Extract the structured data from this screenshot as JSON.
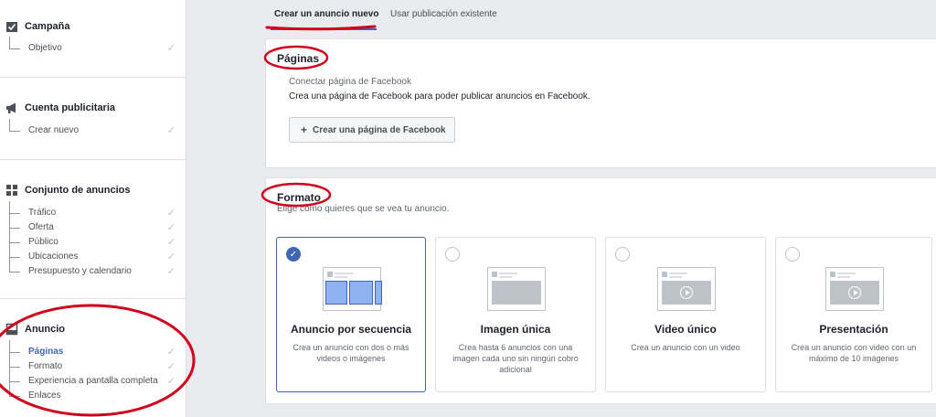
{
  "sidebar": {
    "sections": [
      {
        "title": "Campaña",
        "icon": "checkbox-icon",
        "items": [
          {
            "label": "Objetivo"
          }
        ]
      },
      {
        "title": "Cuenta publicitaria",
        "icon": "megaphone-icon",
        "items": [
          {
            "label": "Crear nuevo"
          }
        ]
      },
      {
        "title": "Conjunto de anuncios",
        "icon": "grid-icon",
        "items": [
          {
            "label": "Tráfico"
          },
          {
            "label": "Oferta"
          },
          {
            "label": "Público"
          },
          {
            "label": "Ubicaciones"
          },
          {
            "label": "Presupuesto y calendario"
          }
        ]
      },
      {
        "title": "Anuncio",
        "icon": "ad-icon",
        "items": [
          {
            "label": "Páginas",
            "active": true
          },
          {
            "label": "Formato"
          },
          {
            "label": "Experiencia a pantalla completa"
          },
          {
            "label": "Enlaces"
          }
        ]
      }
    ],
    "check_glyph": "✓"
  },
  "tabs": [
    {
      "label": "Crear un anuncio nuevo",
      "active": true
    },
    {
      "label": "Usar publicación existente",
      "active": false
    }
  ],
  "pages_card": {
    "title": "Páginas",
    "subtitle": "Conectar página de Facebook",
    "description": "Crea una página de Facebook para poder publicar anuncios en Facebook.",
    "button_label": "Crear una página de Facebook",
    "button_plus": "+"
  },
  "format_card": {
    "title": "Formato",
    "subtitle": "Elige cómo quieres que se vea tu anuncio.",
    "options": [
      {
        "title": "Anuncio por secuencia",
        "description": "Crea un anuncio con dos o más videos o imágenes",
        "selected": true
      },
      {
        "title": "Imagen única",
        "description": "Crea hasta 6 anuncios con una imagen cada uno sin ningún cobro adicional",
        "selected": false
      },
      {
        "title": "Video único",
        "description": "Crea un anuncio con un video",
        "selected": false
      },
      {
        "title": "Presentación",
        "description": "Crea un anuncio con video con un máximo de 10 imágenes",
        "selected": false
      }
    ]
  },
  "colors": {
    "accent": "#4267b2",
    "annotation": "#d0021b"
  }
}
